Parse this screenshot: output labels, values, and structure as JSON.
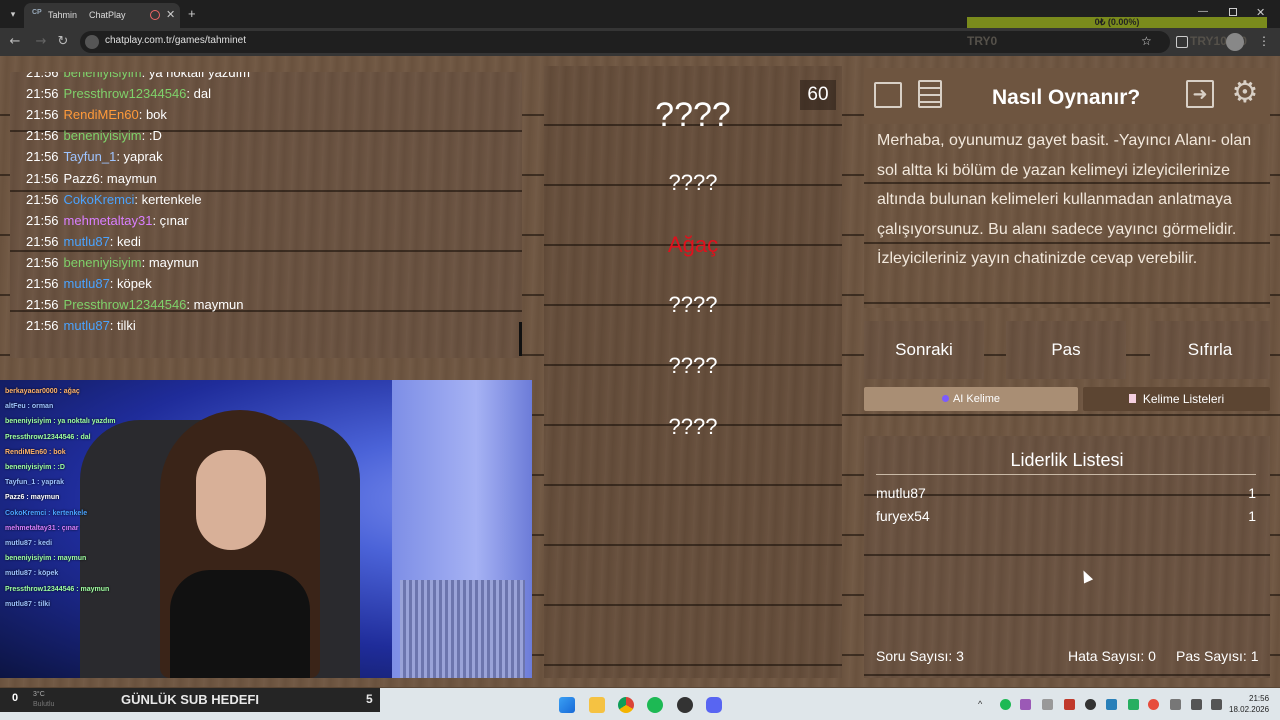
{
  "browser": {
    "tab_title": "Tahmin",
    "tab_title2": "ChatPlay",
    "url": "chatplay.com.tr/games/tahminet"
  },
  "chat": [
    {
      "time": "21:56",
      "user": "beneniyisiyim",
      "color": "#7fd16a",
      "msg": "ya noktalı yazdım"
    },
    {
      "time": "21:56",
      "user": "Pressthrow12344546",
      "color": "#7fd16a",
      "msg": "dal"
    },
    {
      "time": "21:56",
      "user": "RendiMEn60",
      "color": "#ff9a3a",
      "msg": "bok"
    },
    {
      "time": "21:56",
      "user": "beneniyisiyim",
      "color": "#7fd16a",
      "msg": ":D"
    },
    {
      "time": "21:56",
      "user": "Tayfun_1",
      "color": "#9ec4ff",
      "msg": "yaprak"
    },
    {
      "time": "21:56",
      "user": "Pazz6",
      "color": "#ffffff",
      "msg": "maymun"
    },
    {
      "time": "21:56",
      "user": "CokoKremci",
      "color": "#4aa3ff",
      "msg": "kertenkele"
    },
    {
      "time": "21:56",
      "user": "mehmetaltay31",
      "color": "#d97fff",
      "msg": "çınar"
    },
    {
      "time": "21:56",
      "user": "mutlu87",
      "color": "#4aa3ff",
      "msg": "kedi"
    },
    {
      "time": "21:56",
      "user": "beneniyisiyim",
      "color": "#7fd16a",
      "msg": "maymun"
    },
    {
      "time": "21:56",
      "user": "mutlu87",
      "color": "#4aa3ff",
      "msg": "köpek"
    },
    {
      "time": "21:56",
      "user": "Pressthrow12344546",
      "color": "#7fd16a",
      "msg": "maymun"
    },
    {
      "time": "21:56",
      "user": "mutlu87",
      "color": "#4aa3ff",
      "msg": "tilki"
    }
  ],
  "overlay_chat": [
    {
      "text": "berkayacar0000 : ağaç",
      "color": "#ffb36b"
    },
    {
      "text": "altFeu : orman",
      "color": "#9ec4ff"
    },
    {
      "text": "beneniyisiyim : ya noktalı yazdım",
      "color": "#9effa0"
    },
    {
      "text": "Pressthrow12344546 : dal",
      "color": "#9effa0"
    },
    {
      "text": "RendiMEn60 : bok",
      "color": "#ffb36b"
    },
    {
      "text": "beneniyisiyim : :D",
      "color": "#9effa0"
    },
    {
      "text": "Tayfun_1 : yaprak",
      "color": "#9ec4ff"
    },
    {
      "text": "Pazz6 : maymun",
      "color": "#ffffff"
    },
    {
      "text": "CokoKremci : kertenkele",
      "color": "#4aa3ff"
    },
    {
      "text": "mehmetaltay31 : çınar",
      "color": "#d97fff"
    },
    {
      "text": "mutlu87 : kedi",
      "color": "#9ec4ff"
    },
    {
      "text": "beneniyisiyim : maymun",
      "color": "#9effa0"
    },
    {
      "text": "mutlu87 : köpek",
      "color": "#9ec4ff"
    },
    {
      "text": "Pressthrow12344546 : maymun",
      "color": "#9effa0"
    },
    {
      "text": "mutlu87 : tilki",
      "color": "#9ec4ff"
    }
  ],
  "game": {
    "timer": "60",
    "words": [
      "????",
      "????",
      "Ağaç",
      "????",
      "????",
      "????"
    ],
    "active_word_color": "#e0101c"
  },
  "howto": {
    "title": "Nasıl Oynanır?",
    "text": "Merhaba, oyunumuz gayet basit. -Yayıncı Alanı- olan sol altta ki bölüm de yazan kelimeyi izleyicilerinize altında bulunan kelimeleri kullanmadan anlatmaya çalışıyorsunuz. Bu alanı sadece yayıncı görmelidir. İzleyicileriniz yayın chatinizde cevap verebilir."
  },
  "buttons": {
    "next": "Sonraki",
    "pass": "Pas",
    "reset": "Sıfırla",
    "ai_word": "AI Kelime",
    "word_lists": "Kelime Listeleri"
  },
  "leaderboard": {
    "title": "Liderlik Listesi",
    "rows": [
      {
        "name": "mutlu87",
        "score": "1"
      },
      {
        "name": "furyex54",
        "score": "1"
      }
    ],
    "question_count": "Soru Sayısı: 3",
    "error_count": "Hata Sayısı: 0",
    "pass_count": "Pas Sayısı: 1"
  },
  "sub_goal": {
    "label": "GÜNLÜK SUB HEDEFI",
    "current": "0",
    "target": "5"
  },
  "donation_widget": {
    "value": "0₺ (0.00%)",
    "left": "TRY0",
    "right": "TRY10000"
  },
  "weather": {
    "temp": "3°C",
    "desc": "Bulutlu"
  },
  "clock": {
    "time": "21:56",
    "date": "18.02.2026"
  }
}
